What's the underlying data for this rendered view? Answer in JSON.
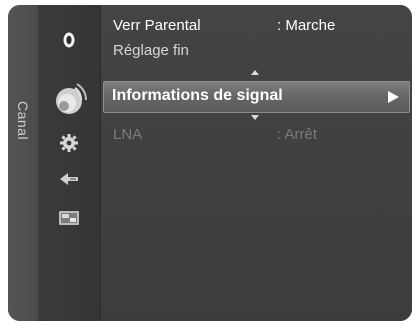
{
  "side_tab": {
    "label": "Canal"
  },
  "icons": [
    {
      "name": "picture-icon",
      "selected": false
    },
    {
      "name": "antenna-dish-icon",
      "selected": true
    },
    {
      "name": "settings-gear-icon",
      "selected": false
    },
    {
      "name": "input-connector-icon",
      "selected": false
    },
    {
      "name": "application-icon",
      "selected": false
    }
  ],
  "menu": {
    "items": [
      {
        "label": "Verr Parental",
        "value": ": Marche"
      },
      {
        "label": "Réglage fin",
        "value": ""
      },
      {
        "label": "Informations de signal",
        "value": ""
      },
      {
        "label": "LNA",
        "value": ": Arrêt"
      }
    ]
  },
  "colors": {
    "highlight": "#6f6f6f",
    "panel": "#404040",
    "text": "#ffffff",
    "disabled_text": "#7b7b7b"
  }
}
